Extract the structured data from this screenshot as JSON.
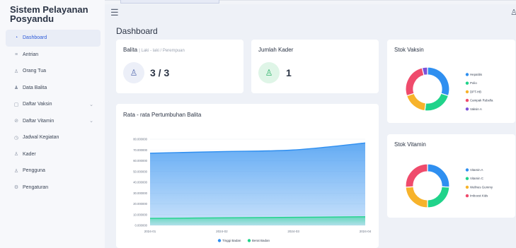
{
  "app": {
    "title_line1": "Sistem Pelayanan",
    "title_line2": "Posyandu"
  },
  "header": {
    "menu_icon": "hamburger-icon",
    "user_icon": "user-icon"
  },
  "sidebar": {
    "items": [
      {
        "label": "Dashboard",
        "icon": "dashboard-icon",
        "active": true
      },
      {
        "label": "Antrian",
        "icon": "queue-icon"
      },
      {
        "label": "Orang Tua",
        "icon": "parent-icon"
      },
      {
        "label": "Data Balita",
        "icon": "children-icon"
      },
      {
        "label": "Daftar Vaksin",
        "icon": "vaccine-icon",
        "expandable": true
      },
      {
        "label": "Daftar Vitamin",
        "icon": "vitamin-icon",
        "expandable": true
      },
      {
        "label": "Jadwal Kegiatan",
        "icon": "clock-icon"
      },
      {
        "label": "Kader",
        "icon": "users-icon"
      },
      {
        "label": "Pengguna",
        "icon": "user-icon"
      },
      {
        "label": "Pengaturan",
        "icon": "gear-icon"
      }
    ]
  },
  "main": {
    "page_title": "Dashboard",
    "balita_card": {
      "label": "Balita",
      "sublabel": "| Laki - laki / Perempuan",
      "value": "3 / 3"
    },
    "kader_card": {
      "label": "Jumlah Kader",
      "value": "1"
    },
    "vaksin_card": {
      "title": "Stok Vaksin"
    },
    "vitamin_card": {
      "title": "Stok Vitamin"
    },
    "growth_card": {
      "title": "Rata - rata Pertumbuhan Balita"
    }
  },
  "colors": {
    "accent": "#2e5bd9",
    "blue": "#2f8ff0",
    "green": "#20d38a",
    "orange": "#f7b32b",
    "red": "#ef4b6c",
    "purple": "#7b52d9"
  },
  "chart_data": [
    {
      "type": "area",
      "title": "Rata - rata Pertumbuhan Balita",
      "x": [
        "2024-01",
        "2024-02",
        "2024-03",
        "2024-04"
      ],
      "y_ticks": [
        "0.000000",
        "10.000000",
        "20.000000",
        "30.000000",
        "40.000000",
        "50.000000",
        "60.000000",
        "70.000000",
        "80.000000"
      ],
      "ylim": [
        0,
        80
      ],
      "series": [
        {
          "name": "Tinggi Badan",
          "values": [
            67,
            68.5,
            70,
            76.5
          ],
          "color": "#2f8ff0"
        },
        {
          "name": "Berat Badan",
          "values": [
            6.5,
            7,
            7.5,
            8
          ],
          "color": "#20d38a"
        }
      ],
      "legend": "bottom"
    },
    {
      "type": "pie",
      "title": "Stok Vaksin",
      "categories": [
        "Hepatitis",
        "Polio",
        "DPT-HB",
        "Campak Rubella",
        "Vaksin A"
      ],
      "values": [
        30,
        22,
        18,
        26,
        4
      ],
      "colors": [
        "#2f8ff0",
        "#20d38a",
        "#f7b32b",
        "#ef4b6c",
        "#7b52d9"
      ],
      "legend": "right"
    },
    {
      "type": "pie",
      "title": "Stok Vitamin",
      "categories": [
        "Vitamin A",
        "Vitamin C",
        "Wellnes Gummy",
        "Imboost Kids"
      ],
      "values": [
        26,
        24,
        24,
        26
      ],
      "colors": [
        "#2f8ff0",
        "#20d38a",
        "#f7b32b",
        "#ef4b6c"
      ],
      "legend": "right"
    }
  ]
}
